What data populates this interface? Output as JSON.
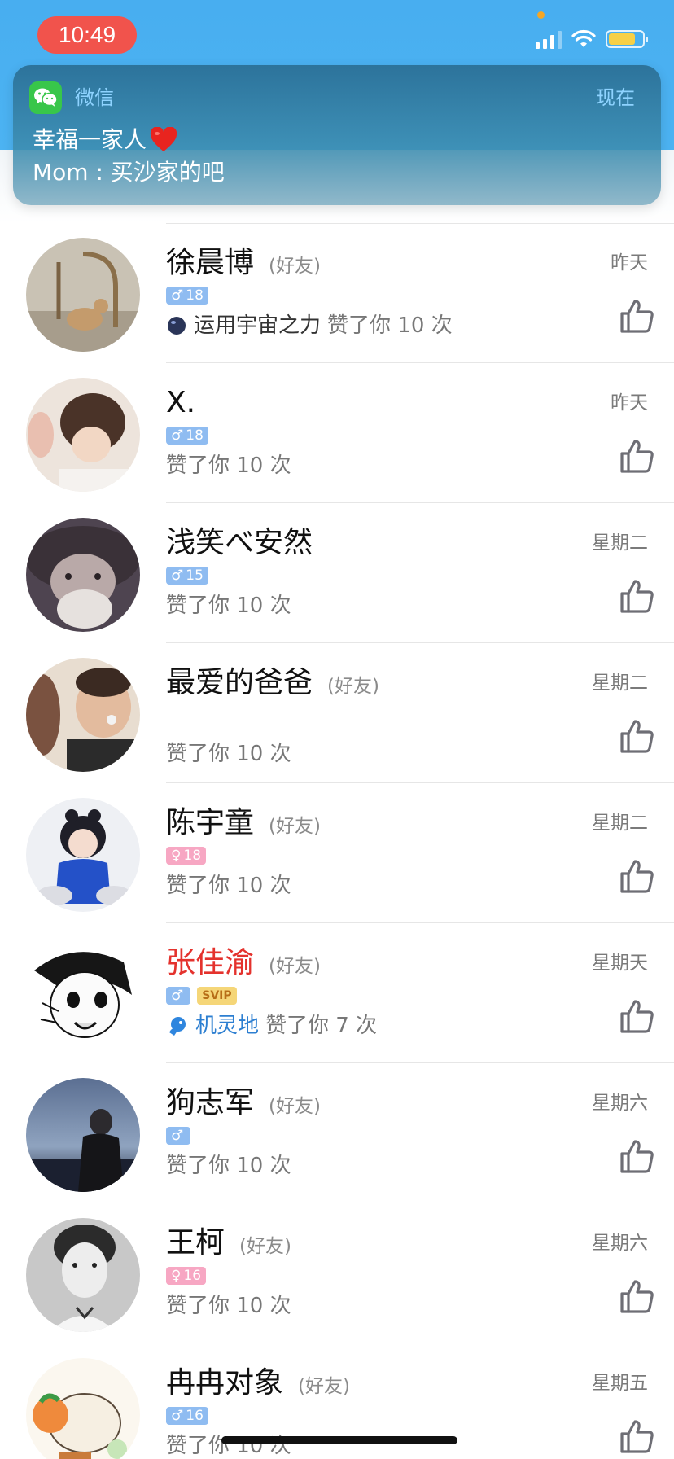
{
  "status_bar": {
    "time": "10:49",
    "signal_bars": 3,
    "battery_level": 0.8,
    "colors": {
      "time_pill": "#f1534c",
      "battery_fill": "#f7d046"
    }
  },
  "notification": {
    "app_name": "微信",
    "time": "现在",
    "title": "幸福一家人",
    "title_icon": "red-heart-icon",
    "body": "Mom : 买沙家的吧"
  },
  "likes": [
    {
      "name": "徐晨博",
      "tag": "(好友)",
      "date": "昨天",
      "gender": "♂",
      "age": "18",
      "vip": false,
      "svip": "",
      "group": "运用宇宙之力",
      "group_icon": "planet-icon",
      "like_text": "赞了你 10 次"
    },
    {
      "name": "X.",
      "tag": "",
      "date": "昨天",
      "gender": "♂",
      "age": "18",
      "vip": false,
      "svip": "",
      "group": "",
      "group_icon": "",
      "like_text": "赞了你 10 次"
    },
    {
      "name": "浅笑べ安然",
      "tag": "",
      "date": "星期二",
      "gender": "♂",
      "age": "15",
      "vip": false,
      "svip": "",
      "group": "",
      "group_icon": "",
      "like_text": "赞了你 10 次"
    },
    {
      "name": "最爱的爸爸",
      "tag": "(好友)",
      "date": "星期二",
      "gender": "",
      "age": "",
      "vip": false,
      "svip": "",
      "group": "",
      "group_icon": "",
      "like_text": "赞了你 10 次"
    },
    {
      "name": "陈宇童",
      "tag": "(好友)",
      "date": "星期二",
      "gender": "♀",
      "age": "18",
      "vip": false,
      "svip": "",
      "group": "",
      "group_icon": "",
      "like_text": "赞了你 10 次"
    },
    {
      "name": "张佳渝",
      "tag": "(好友)",
      "date": "星期天",
      "gender": "♂",
      "age": "",
      "vip": true,
      "svip": "SVIP",
      "group": "机灵地",
      "group_icon": "blue-pet-icon",
      "like_text": "赞了你 7 次"
    },
    {
      "name": "狗志军",
      "tag": "(好友)",
      "date": "星期六",
      "gender": "♂",
      "age": "",
      "vip": false,
      "svip": "",
      "group": "",
      "group_icon": "",
      "like_text": "赞了你 10 次"
    },
    {
      "name": "王柯",
      "tag": "(好友)",
      "date": "星期六",
      "gender": "♀",
      "age": "16",
      "vip": false,
      "svip": "",
      "group": "",
      "group_icon": "",
      "like_text": "赞了你 10 次"
    },
    {
      "name": "冉冉对象",
      "tag": "(好友)",
      "date": "星期五",
      "gender": "♂",
      "age": "16",
      "vip": false,
      "svip": "",
      "group": "",
      "group_icon": "",
      "like_text": "赞了你 10 次"
    }
  ]
}
